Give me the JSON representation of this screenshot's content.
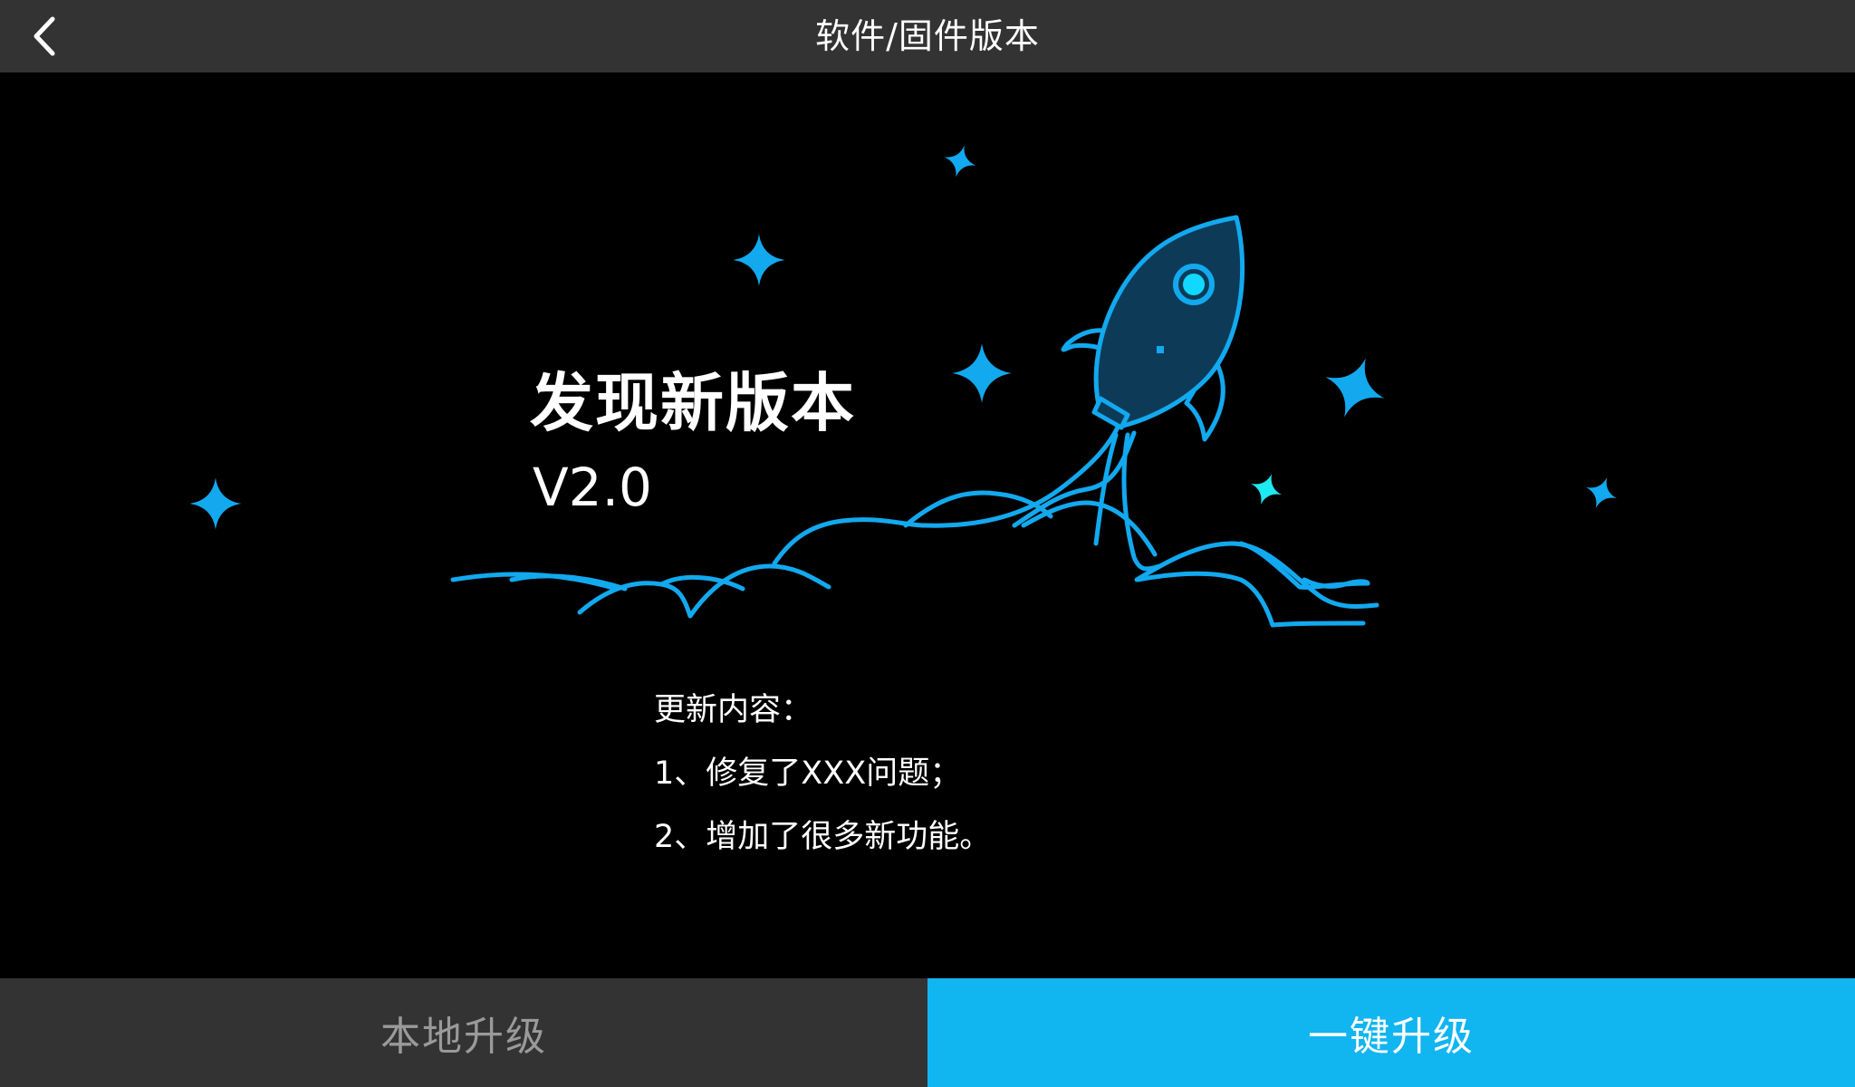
{
  "header": {
    "title": "软件/固件版本",
    "back_icon": "chevron-left-icon"
  },
  "hero": {
    "headline": "发现新版本",
    "version": "V2.0",
    "illustration_icon": "rocket-icon"
  },
  "release_notes": {
    "heading": "更新内容：",
    "items": [
      "1、修复了XXX问题；",
      "2、增加了很多新功能。"
    ]
  },
  "footer": {
    "local_upgrade_label": "本地升级",
    "one_click_upgrade_label": "一键升级"
  },
  "colors": {
    "background": "#000000",
    "header_bar": "#333333",
    "accent": "#11b5f0",
    "illustration_stroke": "#12a9ef",
    "rocket_fill": "#0d3b57",
    "porthole": "#11d8ff",
    "secondary_button_text": "#9a9a9a"
  }
}
